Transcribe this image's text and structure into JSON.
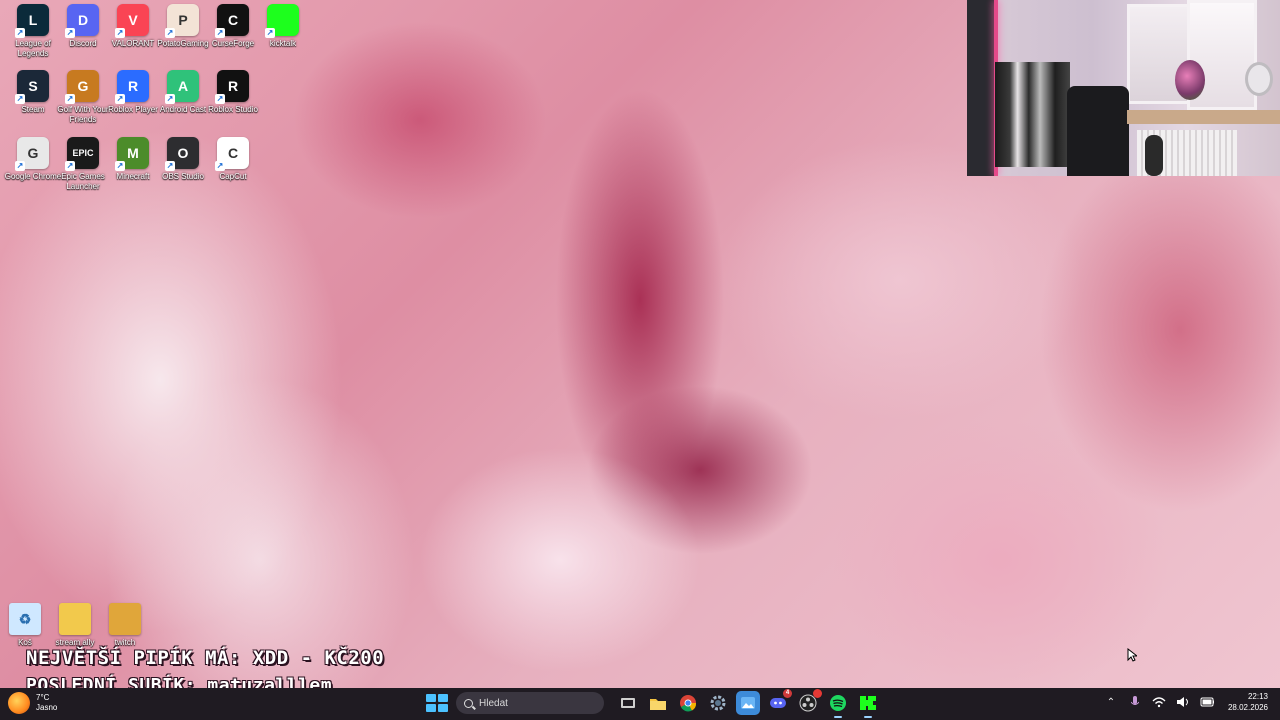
{
  "desktop": {
    "icons_top": [
      {
        "label": "League of Legends",
        "text": "L",
        "color": "#0b2a3a"
      },
      {
        "label": "Discord",
        "text": "D",
        "color": "#5865f2"
      },
      {
        "label": "VALORANT",
        "text": "V",
        "color": "#fa4454"
      },
      {
        "label": "PotatoGaming",
        "text": "P",
        "color": "#f3e3d6"
      },
      {
        "label": "CurseForge",
        "text": "C",
        "color": "#111111"
      },
      {
        "label": "kicktalk",
        "text": "",
        "color": "#1dff1d"
      },
      {
        "label": "Steam",
        "text": "S",
        "color": "#1b2838"
      },
      {
        "label": "Golf With Your Friends",
        "text": "G",
        "color": "#c77a20"
      },
      {
        "label": "Roblox Player",
        "text": "R",
        "color": "#2b6cff"
      },
      {
        "label": "Android Cast",
        "text": "A",
        "color": "#2fc27a"
      },
      {
        "label": "Roblox Studio",
        "text": "R",
        "color": "#111111"
      },
      {
        "label": "Google Chrome",
        "text": "G",
        "color": "#e8e8e8"
      },
      {
        "label": "Epic Games Launcher",
        "text": "EPIC",
        "color": "#1a1a1a"
      },
      {
        "label": "Minecraft",
        "text": "M",
        "color": "#4c8c2a"
      },
      {
        "label": "OBS Studio",
        "text": "O",
        "color": "#2d2d30"
      },
      {
        "label": "CapCut",
        "text": "C",
        "color": "#ffffff"
      }
    ],
    "icons_bottom": [
      {
        "label": "Koš",
        "text": "♻",
        "color": "#cfe8ff"
      },
      {
        "label": "stream ally",
        "text": "",
        "color": "#f2c94c"
      },
      {
        "label": "twitch",
        "text": "",
        "color": "#e0a63a"
      }
    ]
  },
  "overlay": {
    "line1": "NEJVĚTŠÍ PIPÍK MÁ: XDD - KČ200",
    "line2": "POSLEDNÍ SUBÍK: matuzalllem"
  },
  "taskbar": {
    "weather_temp": "7°C",
    "weather_cond": "Jasno",
    "search_placeholder": "Hledat",
    "discord_badge": "4",
    "time": "22:13",
    "date": "28.02.2026"
  }
}
